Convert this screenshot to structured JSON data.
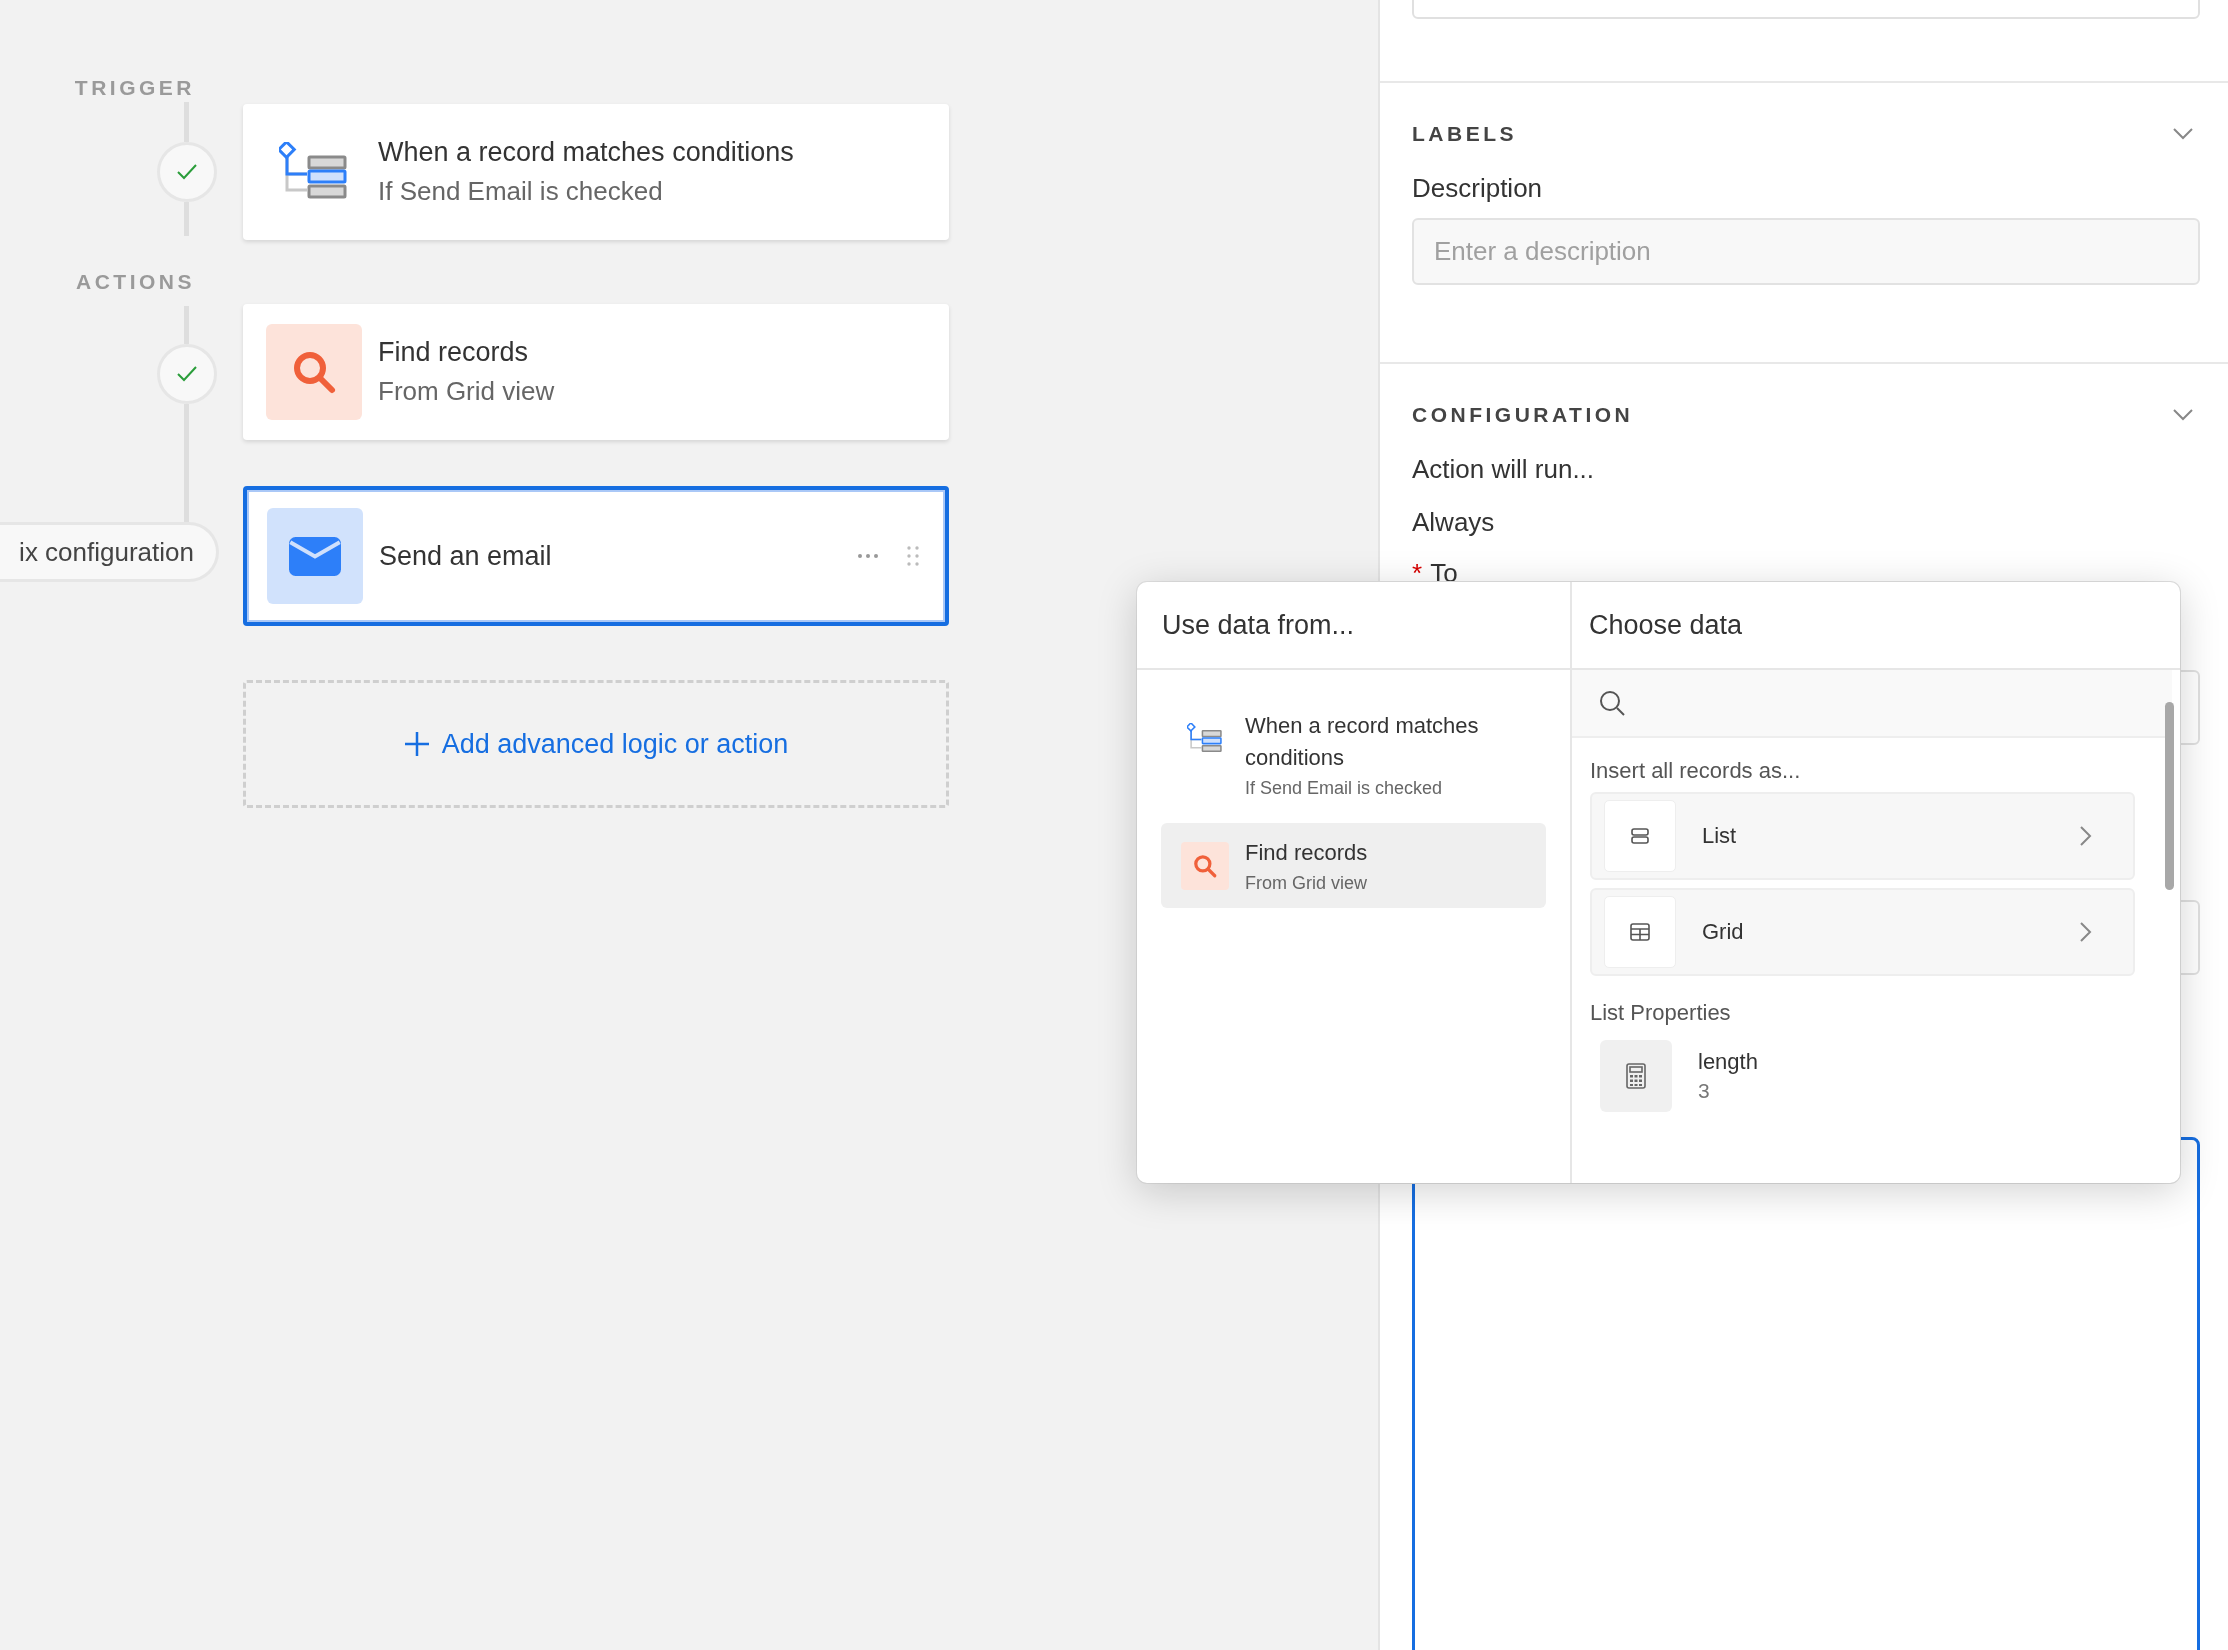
{
  "flow": {
    "trigger_label": "TRIGGER",
    "actions_label": "ACTIONS",
    "steps": [
      {
        "kind": "trigger",
        "title": "When a record matches conditions",
        "subtitle": "If Send Email is checked",
        "done": true,
        "selected": false
      },
      {
        "kind": "find",
        "title": "Find records",
        "subtitle": "From Grid view",
        "done": true,
        "selected": false
      },
      {
        "kind": "email",
        "title": "Send an email",
        "warning": "ix configuration",
        "selected": true
      }
    ],
    "add_button": {
      "label": "Add advanced logic or action"
    }
  },
  "panel": {
    "labels": {
      "title": "LABELS",
      "expanded": true,
      "description_label": "Description",
      "description_placeholder": "Enter a description"
    },
    "configuration": {
      "title": "CONFIGURATION",
      "expanded": true,
      "run_label": "Action will run...",
      "run_value": "Always",
      "required_mark": "*",
      "to_label": "To"
    }
  },
  "popup": {
    "source_title": "Use data from...",
    "sources": [
      {
        "kind": "trigger",
        "title": "When a record matches conditions",
        "subtitle": "If Send Email is checked",
        "selected": false
      },
      {
        "kind": "find",
        "title": "Find records",
        "subtitle": "From Grid view",
        "selected": true
      }
    ],
    "choose_title": "Choose data",
    "insert_label": "Insert all records as...",
    "formats": [
      {
        "kind": "list",
        "label": "List"
      },
      {
        "kind": "grid",
        "label": "Grid"
      }
    ],
    "properties_label": "List Properties",
    "properties": [
      {
        "name": "length",
        "value": "3"
      }
    ]
  }
}
